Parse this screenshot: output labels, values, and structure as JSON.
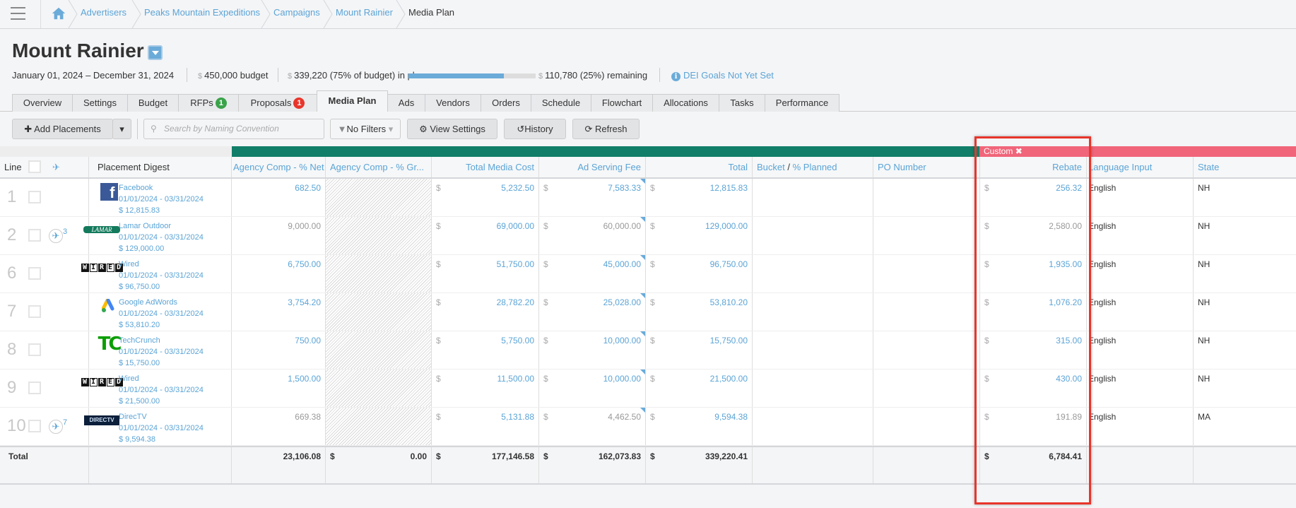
{
  "breadcrumb": [
    "Advertisers",
    "Peaks Mountain Expeditions",
    "Campaigns",
    "Mount Rainier",
    "Media Plan"
  ],
  "header": {
    "title": "Mount Rainier",
    "dates": "January 01, 2024 – December 31, 2024",
    "currency": "$",
    "budget": "450,000 budget",
    "in_plan": "339,220 (75% of budget) in plan",
    "plan_progress_pct": 75,
    "remaining": "110,780 (25%) remaining",
    "dei": "DEI Goals Not Yet Set"
  },
  "tabs": [
    {
      "label": "Overview"
    },
    {
      "label": "Settings"
    },
    {
      "label": "Budget"
    },
    {
      "label": "RFPs",
      "badge": "1",
      "badge_color": "#3aa34a"
    },
    {
      "label": "Proposals",
      "badge": "1",
      "badge_color": "#e8352b"
    },
    {
      "label": "Media Plan",
      "active": true
    },
    {
      "label": "Ads"
    },
    {
      "label": "Vendors"
    },
    {
      "label": "Orders"
    },
    {
      "label": "Schedule"
    },
    {
      "label": "Flowchart"
    },
    {
      "label": "Allocations"
    },
    {
      "label": "Tasks"
    },
    {
      "label": "Performance"
    }
  ],
  "toolbar": {
    "add_placements": "Add Placements",
    "search_placeholder": "Search by Naming Convention",
    "filters": "No Filters",
    "view_settings": "View Settings",
    "history": "History",
    "refresh": "Refresh"
  },
  "group_band": {
    "custom_label": "Custom",
    "green": "#117e69",
    "pink": "#f0657a"
  },
  "columns": [
    "Line",
    "Placement Digest",
    "Agency Comp - % Net",
    "Agency Comp - % Gr...",
    "Total Media Cost",
    "Ad Serving Fee",
    "Total",
    "Bucket",
    "% Planned",
    "PO Number",
    "Rebate",
    "Language Input",
    "State"
  ],
  "rows": [
    {
      "line": "1",
      "flights": "",
      "logo": "facebook",
      "logo_text": "f",
      "name": "Facebook",
      "dates": "01/01/2024 - 03/31/2024",
      "amount": "$ 12,815.83",
      "ac_net": "682.50",
      "ac_net_grey": false,
      "tmc": "5,232.50",
      "asf": "7,583.33",
      "asf_grey": false,
      "total": "12,815.83",
      "rebate": "256.32",
      "rebate_grey": false,
      "language": "English",
      "state": "NH"
    },
    {
      "line": "2",
      "flights": "3",
      "logo": "lamar",
      "logo_text": "LAMAR",
      "name": "Lamar Outdoor",
      "dates": "01/01/2024 - 03/31/2024",
      "amount": "$ 129,000.00",
      "ac_net": "9,000.00",
      "ac_net_grey": true,
      "tmc": "69,000.00",
      "asf": "60,000.00",
      "asf_grey": true,
      "total": "129,000.00",
      "rebate": "2,580.00",
      "rebate_grey": true,
      "language": "English",
      "state": "NH"
    },
    {
      "line": "6",
      "flights": "",
      "logo": "wired",
      "logo_text": "WIRED",
      "name": "Wired",
      "dates": "01/01/2024 - 03/31/2024",
      "amount": "$ 96,750.00",
      "ac_net": "6,750.00",
      "ac_net_grey": false,
      "tmc": "51,750.00",
      "asf": "45,000.00",
      "asf_grey": false,
      "total": "96,750.00",
      "rebate": "1,935.00",
      "rebate_grey": false,
      "language": "English",
      "state": "NH"
    },
    {
      "line": "7",
      "flights": "",
      "logo": "google-ads",
      "logo_text": "Google Ads",
      "name": "Google AdWords",
      "dates": "01/01/2024 - 03/31/2024",
      "amount": "$ 53,810.20",
      "ac_net": "3,754.20",
      "ac_net_grey": false,
      "tmc": "28,782.20",
      "asf": "25,028.00",
      "asf_grey": false,
      "total": "53,810.20",
      "rebate": "1,076.20",
      "rebate_grey": false,
      "language": "English",
      "state": "NH"
    },
    {
      "line": "8",
      "flights": "",
      "logo": "techcrunch",
      "logo_text": "TC",
      "name": "TechCrunch",
      "dates": "01/01/2024 - 03/31/2024",
      "amount": "$ 15,750.00",
      "ac_net": "750.00",
      "ac_net_grey": false,
      "tmc": "5,750.00",
      "asf": "10,000.00",
      "asf_grey": false,
      "total": "15,750.00",
      "rebate": "315.00",
      "rebate_grey": false,
      "language": "English",
      "state": "NH"
    },
    {
      "line": "9",
      "flights": "",
      "logo": "wired",
      "logo_text": "WIRED",
      "name": "Wired",
      "dates": "01/01/2024 - 03/31/2024",
      "amount": "$ 21,500.00",
      "ac_net": "1,500.00",
      "ac_net_grey": false,
      "tmc": "11,500.00",
      "asf": "10,000.00",
      "asf_grey": false,
      "total": "21,500.00",
      "rebate": "430.00",
      "rebate_grey": false,
      "language": "English",
      "state": "NH"
    },
    {
      "line": "10",
      "flights": "7",
      "logo": "directv",
      "logo_text": "DIRECTV",
      "name": "DirecTV",
      "dates": "01/01/2024 - 03/31/2024",
      "amount": "$ 9,594.38",
      "ac_net": "669.38",
      "ac_net_grey": true,
      "tmc": "5,131.88",
      "asf": "4,462.50",
      "asf_grey": true,
      "total": "9,594.38",
      "rebate": "191.89",
      "rebate_grey": true,
      "language": "English",
      "state": "MA"
    }
  ],
  "totals": {
    "label": "Total",
    "ac_net": "23,106.08",
    "ac_gross": "0.00",
    "tmc": "177,146.58",
    "asf": "162,073.83",
    "total": "339,220.41",
    "rebate": "6,784.41"
  },
  "colors": {
    "link": "#5ba4d6",
    "highlight_box": "#e8352b"
  }
}
